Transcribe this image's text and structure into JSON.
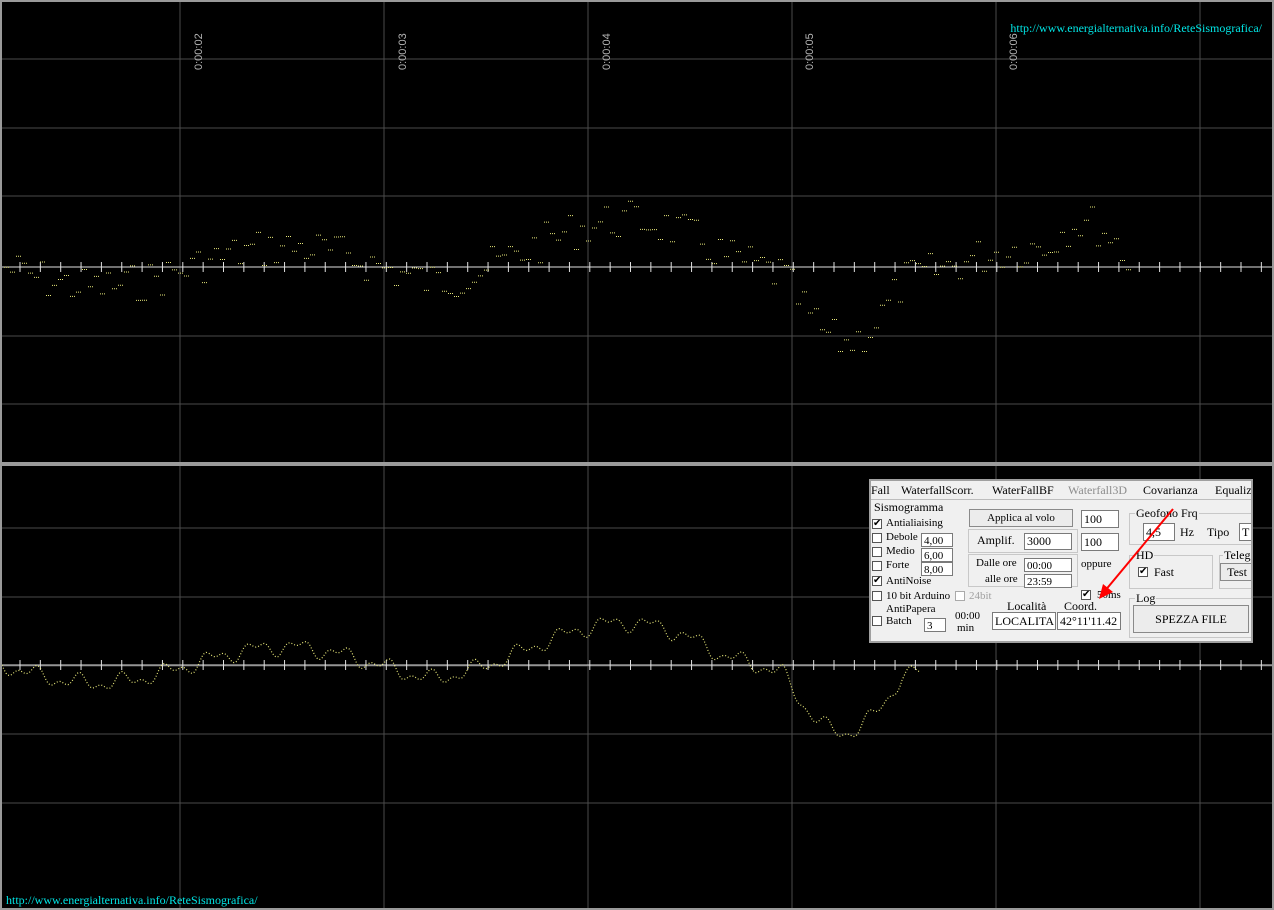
{
  "top_panel": {
    "url": "http://www.energialternativa.info/ReteSismografica/",
    "time_labels": [
      "0:00:02",
      "0:00:03",
      "0:00:04",
      "0:00:05",
      "0:00:06"
    ]
  },
  "bottom_panel": {
    "url": "http://www.energialternativa.info/ReteSismografica/"
  },
  "colors": {
    "background": "#000000",
    "grid": "#4a4a4a",
    "axis": "#e0e0e0",
    "trace": "#e8e87a",
    "url": "#00e6e6",
    "arrow": "#ff0000"
  },
  "control_panel": {
    "tabs": [
      "Fall",
      "WaterfallScorr.",
      "WaterFallBF",
      "Waterfall3D",
      "Covarianza",
      "Equaliz"
    ],
    "sismogramma": {
      "title": "Sismogramma",
      "antialiaising": {
        "label": "Antialiaising",
        "checked": true
      },
      "debole": {
        "label": "Debole",
        "value": "4,00",
        "checked": false
      },
      "medio": {
        "label": "Medio",
        "value": "6,00",
        "checked": false
      },
      "forte": {
        "label": "Forte",
        "value": "8,00",
        "checked": false
      },
      "antinoise": {
        "label": "AntiNoise",
        "checked": true
      },
      "arduino": {
        "label": "10 bit Arduino",
        "checked": false
      },
      "bit24": {
        "label": "24bit",
        "checked": false
      },
      "antipapera": {
        "label": "AntiPapera"
      },
      "batch": {
        "label": "Batch",
        "value": "3",
        "checked": false
      },
      "batch_time": "00:00",
      "batch_unit": "min"
    },
    "applica_button": "Applica al volo",
    "applica_value": "100",
    "amplif_label": "Amplif.",
    "amplif_value": "3000",
    "amplif_value2": "100",
    "dalle_label": "Dalle ore",
    "dalle_value": "00:00",
    "alle_label": "alle ore",
    "alle_value": "23:59",
    "oppure": "oppure",
    "ms50": {
      "label": "50ms",
      "checked": true
    },
    "localita_label": "Località",
    "localita_value": "LOCALITA",
    "coord_label": "Coord.",
    "coord_value": "42°11'11.42",
    "geofono": {
      "title": "Geofono Frq",
      "value": "4,5",
      "unit": "Hz",
      "tipo_label": "Tipo",
      "tipo_value": "T"
    },
    "hd": {
      "title": "HD",
      "fast_label": "Fast",
      "fast_checked": true
    },
    "teleg": {
      "title": "Teleg",
      "test_button": "Test"
    },
    "log": {
      "title": "Log",
      "spezza_button": "SPEZZA FILE"
    }
  }
}
